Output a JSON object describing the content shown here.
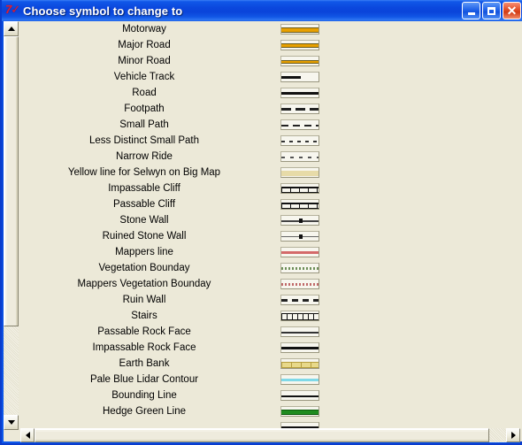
{
  "window": {
    "title": "Choose symbol to change to",
    "icon": "app-icon-red-glyph",
    "controls": {
      "minimize": "_",
      "maximize": "□",
      "close": "×"
    }
  },
  "scrollbars": {
    "vertical": {
      "position": "left",
      "up_arrow": "▲",
      "down_arrow": "▼"
    },
    "horizontal": {
      "left_arrow": "◄",
      "right_arrow": "►"
    }
  },
  "list": {
    "items": [
      {
        "label": "Motorway",
        "symbol": "motorway-swatch"
      },
      {
        "label": "Major Road",
        "symbol": "major-road-swatch"
      },
      {
        "label": "Minor Road",
        "symbol": "minor-road-swatch"
      },
      {
        "label": "Vehicle Track",
        "symbol": "vehicle-track-swatch"
      },
      {
        "label": "Road",
        "symbol": "road-swatch"
      },
      {
        "label": "Footpath",
        "symbol": "footpath-swatch"
      },
      {
        "label": "Small Path",
        "symbol": "small-path-swatch"
      },
      {
        "label": "Less Distinct Small Path",
        "symbol": "less-distinct-small-path-swatch"
      },
      {
        "label": "Narrow Ride",
        "symbol": "narrow-ride-swatch"
      },
      {
        "label": "Yellow line for Selwyn on Big Map",
        "symbol": "yellow-line-selwyn-swatch"
      },
      {
        "label": "Impassable Cliff",
        "symbol": "impassable-cliff-swatch"
      },
      {
        "label": "Passable Cliff",
        "symbol": "passable-cliff-swatch"
      },
      {
        "label": "Stone Wall",
        "symbol": "stone-wall-swatch"
      },
      {
        "label": "Ruined Stone Wall",
        "symbol": "ruined-stone-wall-swatch"
      },
      {
        "label": "Mappers line",
        "symbol": "mappers-line-swatch"
      },
      {
        "label": "Vegetation Bounday",
        "symbol": "vegetation-bounday-swatch"
      },
      {
        "label": "Mappers Vegetation Bounday",
        "symbol": "mappers-vegetation-bounday-swatch"
      },
      {
        "label": "Ruin Wall",
        "symbol": "ruin-wall-swatch"
      },
      {
        "label": "Stairs",
        "symbol": "stairs-swatch"
      },
      {
        "label": "Passable Rock Face",
        "symbol": "passable-rock-face-swatch"
      },
      {
        "label": "Impassable Rock Face",
        "symbol": "impassable-rock-face-swatch"
      },
      {
        "label": "Earth Bank",
        "symbol": "earth-bank-swatch"
      },
      {
        "label": "Pale Blue Lidar Contour",
        "symbol": "pale-blue-lidar-contour-swatch"
      },
      {
        "label": "Bounding Line",
        "symbol": "bounding-line-swatch"
      },
      {
        "label": "Hedge Green Line",
        "symbol": "hedge-green-line-swatch"
      },
      {
        "label": "",
        "symbol": "partial-row-swatch"
      }
    ]
  },
  "colors": {
    "title_bar_blue": "#0b47dd",
    "window_background": "#ece9d8",
    "motorway_orange": "#e8a000",
    "mappers_line_red": "#d46a6a",
    "vegetation_green": "#6e8f5a",
    "lidar_cyan": "#7fd9e8",
    "hedge_green": "#1f8b1f",
    "earth_bank_yellow": "#e8d98a",
    "close_button_red": "#d23c16"
  }
}
